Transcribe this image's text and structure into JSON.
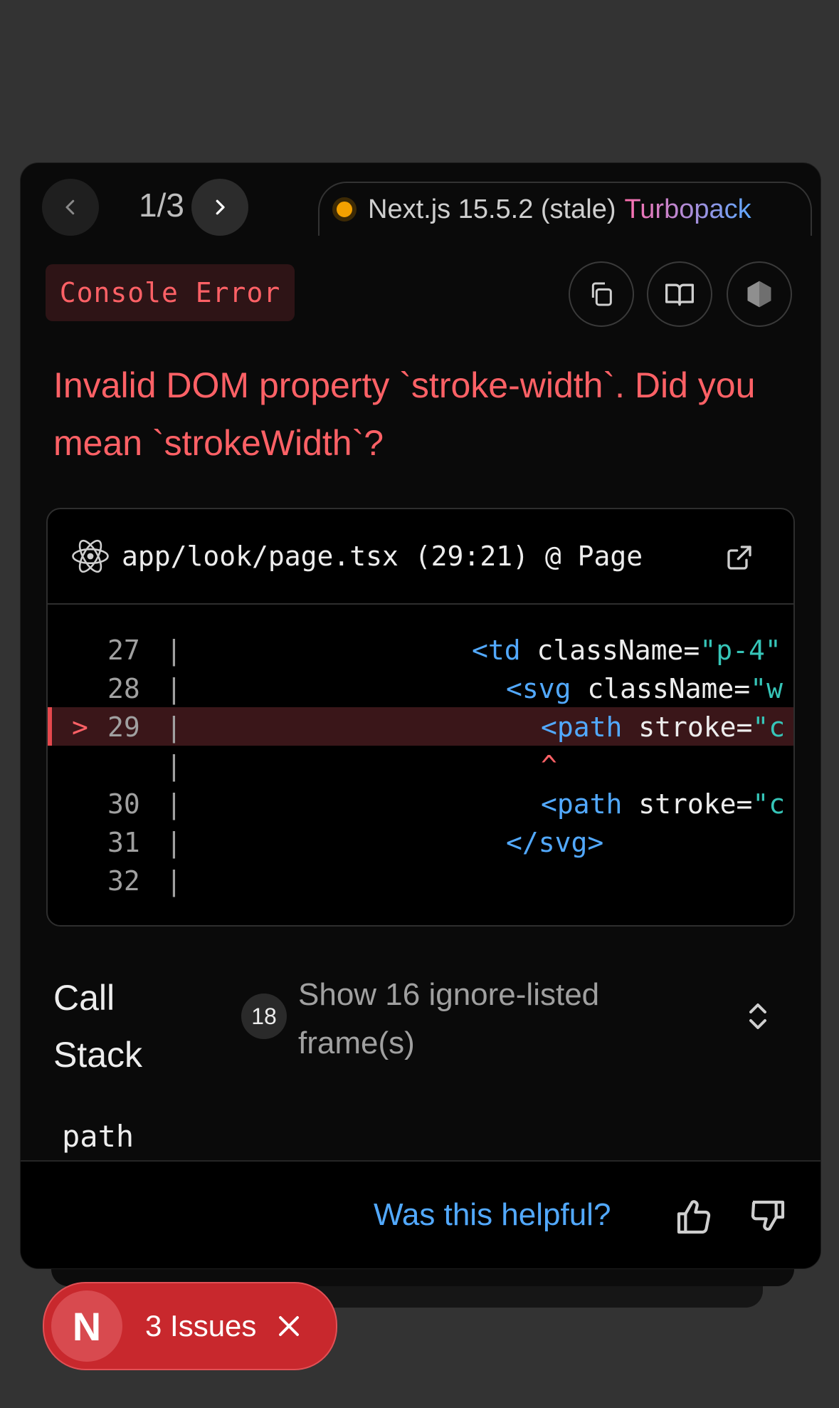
{
  "nav": {
    "page_count": "1/3",
    "version": "Next.js 15.5.2 (stale)",
    "bundler": "Turbopack"
  },
  "error": {
    "type_badge": "Console Error",
    "message": "Invalid DOM property `stroke-width`. Did you mean `strokeWidth`?"
  },
  "code_frame": {
    "file": "app/look/page.tsx (29:21) @ Page",
    "lines": [
      {
        "marker": "",
        "num": "27",
        "bar": "|",
        "indent": "                  ",
        "tag": "<td",
        "attr": " className=",
        "str": "\"p-4\""
      },
      {
        "marker": "",
        "num": "28",
        "bar": "|",
        "indent": "                    ",
        "tag": "<svg",
        "attr": " className=",
        "str": "\"w"
      },
      {
        "marker": ">",
        "num": "29",
        "bar": "|",
        "indent": "                      ",
        "tag": "<path",
        "attr": " stroke=",
        "str": "\"c"
      },
      {
        "marker": "",
        "num": "",
        "bar": "|",
        "indent": "                      ",
        "caret": "^"
      },
      {
        "marker": "",
        "num": "30",
        "bar": "|",
        "indent": "                      ",
        "tag": "<path",
        "attr": " stroke=",
        "str": "\"c"
      },
      {
        "marker": "",
        "num": "31",
        "bar": "|",
        "indent": "                    ",
        "tag": "</svg>",
        "attr": "",
        "str": ""
      },
      {
        "marker": "",
        "num": "32",
        "bar": "|",
        "indent": "",
        "tag": "",
        "attr": "",
        "str": ""
      }
    ]
  },
  "call_stack": {
    "title": "Call Stack",
    "count": "18",
    "toggle_label": "Show 16 ignore-listed frame(s)",
    "first_frame": "path"
  },
  "footer": {
    "helpful_label": "Was this helpful?"
  },
  "issues_pill": {
    "logo": "N",
    "label": "3 Issues"
  },
  "colors": {
    "error": "#ff6166",
    "link": "#52a9ff",
    "issues_bg": "#c8282d"
  }
}
